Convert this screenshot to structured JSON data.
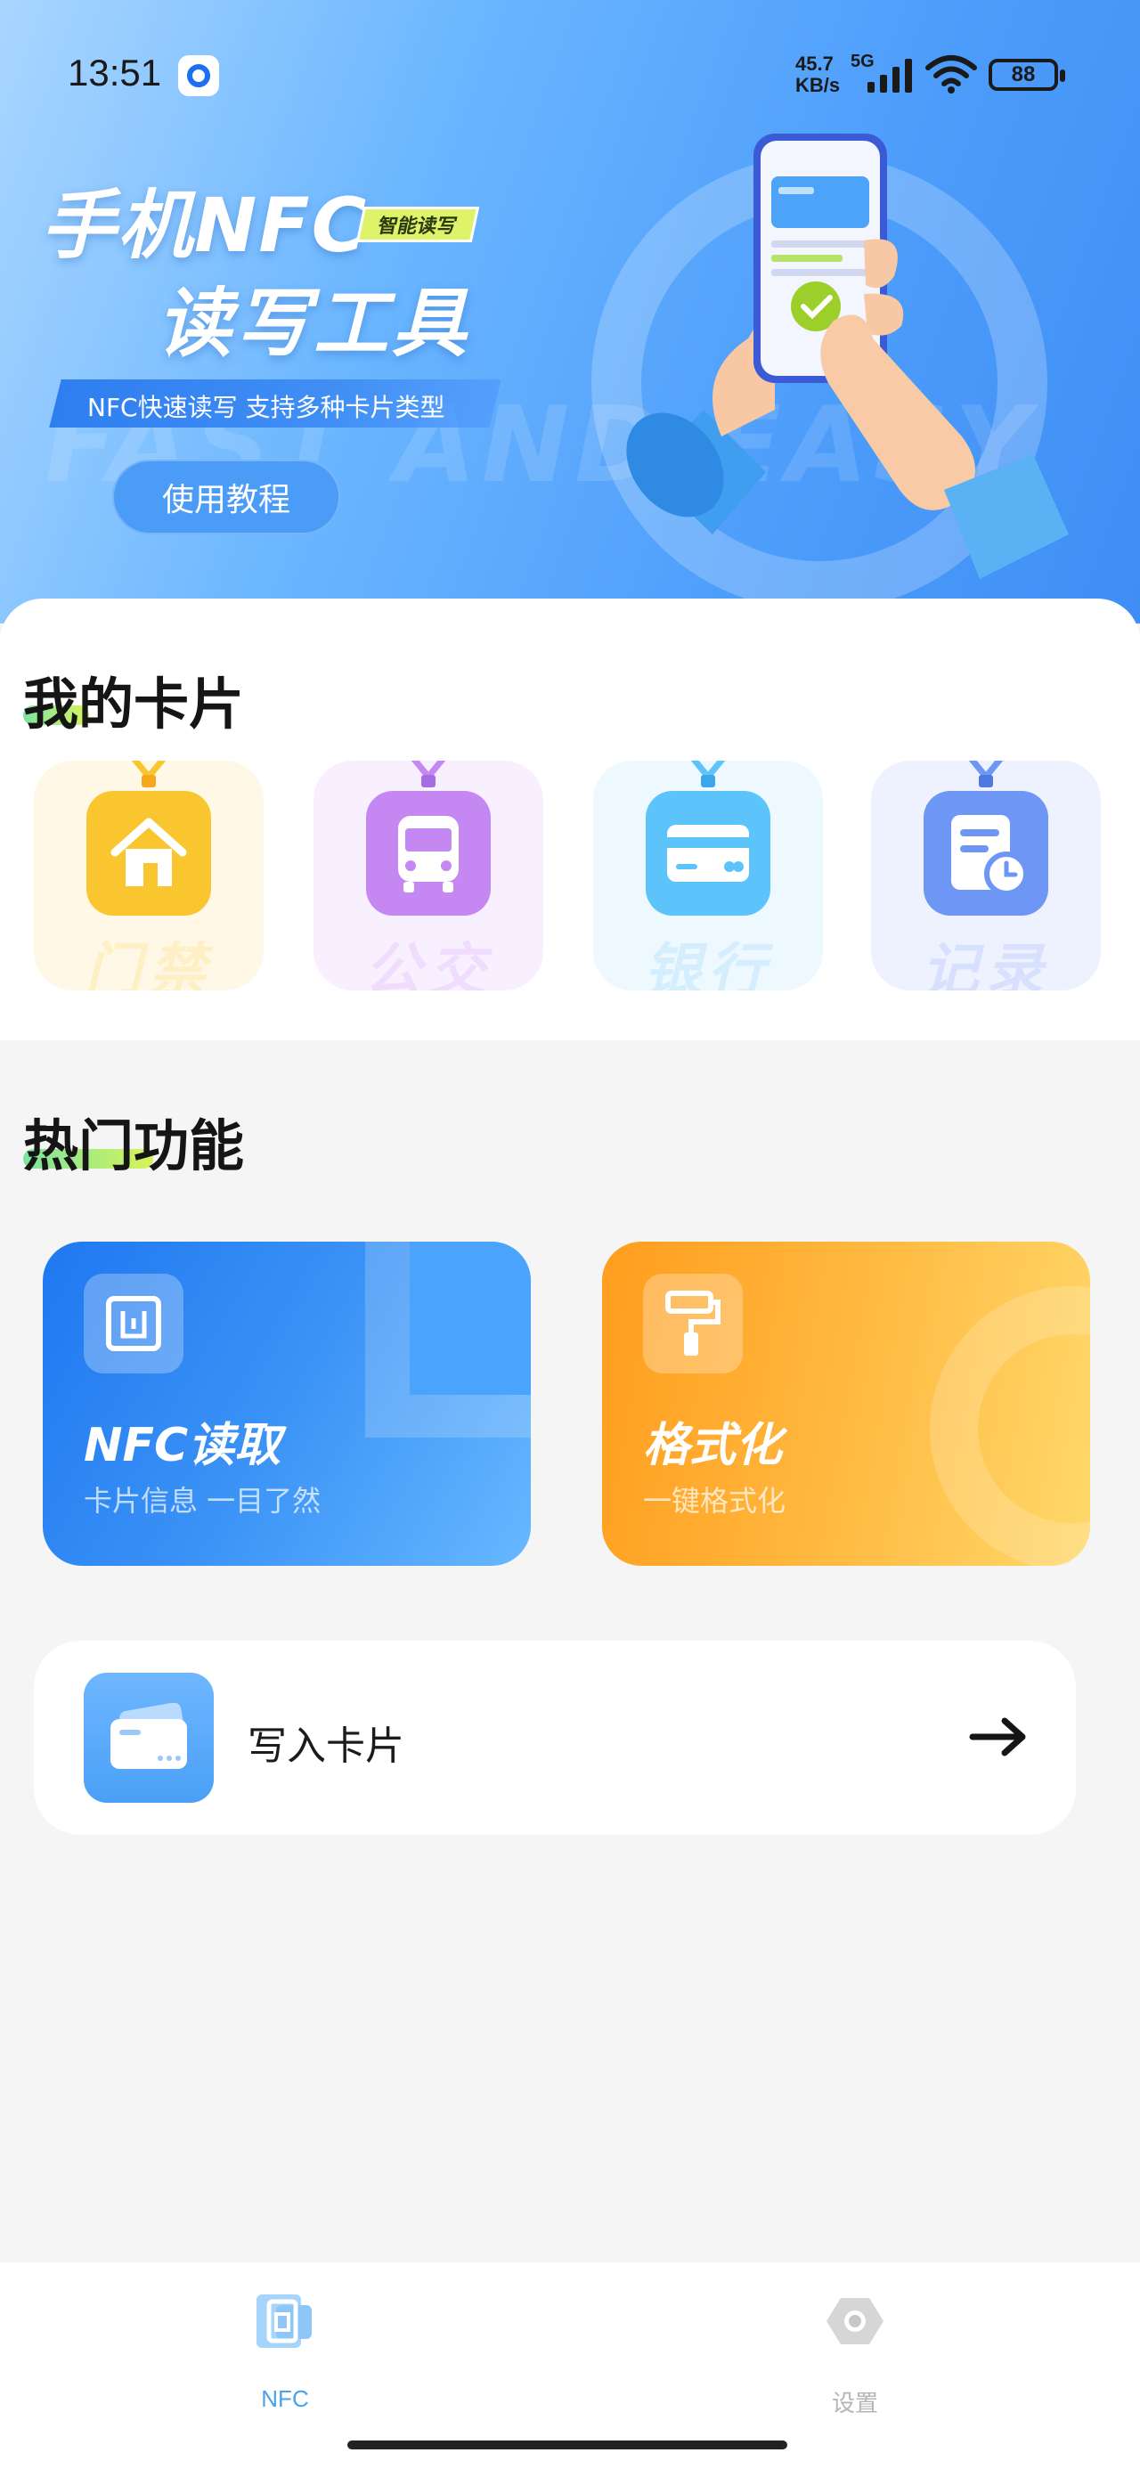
{
  "status_bar": {
    "time": "13:51",
    "net_speed_value": "45.7",
    "net_speed_unit": "KB/s",
    "net_type": "5G",
    "battery": "88"
  },
  "banner": {
    "title_line1": "手机NFC",
    "tag": "智能读写",
    "title_line2": "读写工具",
    "subtitle": "NFC快速读写  支持多种卡片类型",
    "watermark": "FAST AND EASY",
    "tutorial_button": "使用教程"
  },
  "my_cards": {
    "title": "我的卡片",
    "items": [
      {
        "label": "门禁",
        "icon": "house-icon",
        "color": "#f9c630",
        "tint": "#fff9e9"
      },
      {
        "label": "公交",
        "icon": "bus-icon",
        "color": "#c587f2",
        "tint": "#f8efff"
      },
      {
        "label": "银行",
        "icon": "bank-card-icon",
        "color": "#5cc3fb",
        "tint": "#eef8ff"
      },
      {
        "label": "记录",
        "icon": "record-clock-icon",
        "color": "#6e96f4",
        "tint": "#eef2ff"
      }
    ]
  },
  "hot_features": {
    "title": "热门功能",
    "cards": [
      {
        "title": "NFC读取",
        "subtitle": "卡片信息 一目了然",
        "icon": "nfc-chip-icon"
      },
      {
        "title": "格式化",
        "subtitle": "一键格式化",
        "icon": "paint-roller-icon"
      }
    ],
    "write_row": {
      "label": "写入卡片",
      "icon": "card-write-icon",
      "arrow": "arrow-right-icon"
    }
  },
  "bottom_nav": {
    "items": [
      {
        "label": "NFC",
        "icon": "nfc-tab-icon",
        "active": true
      },
      {
        "label": "设置",
        "icon": "settings-hex-icon",
        "active": false
      }
    ]
  },
  "colors": {
    "accent": "#3f8ef5",
    "active_tab": "#4aa3e8",
    "inactive_tab": "#b5b5b5"
  }
}
